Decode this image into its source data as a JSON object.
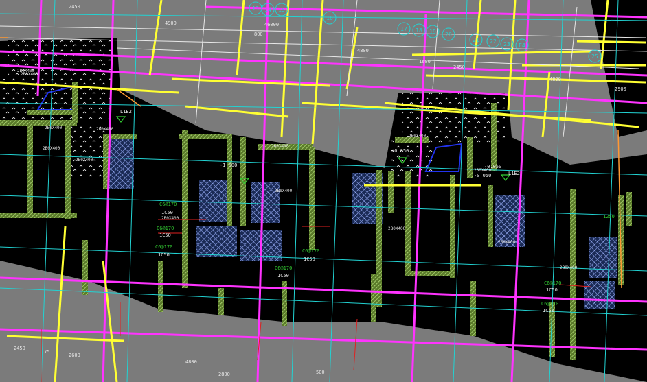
{
  "drawing": {
    "background": "#000000",
    "gray_fill": "#7b7b7b",
    "colors": {
      "magenta": "#ff33ff",
      "yellow": "#ffff33",
      "cyan": "#22d3d3",
      "white": "#e8e8e8",
      "green": "#33cc33",
      "red": "#e02020",
      "blue": "#2233ee",
      "orange": "#ff9933",
      "hatch": "#9fd36a"
    }
  },
  "grid_labels": [
    "13",
    "14",
    "15",
    "16",
    "17",
    "18",
    "19",
    "20",
    "21",
    "22",
    "23",
    "E4",
    "25"
  ],
  "dimensions": [
    "2450",
    "4900",
    "800",
    "46000",
    "4800",
    "1600",
    "2450",
    "4800",
    "2900",
    "2450",
    "175",
    "2600",
    "4800",
    "2800",
    "500"
  ],
  "room_tags": [
    "2B0X400",
    "2B0X400",
    "2B0X400",
    "2B0X400",
    "2B0X400",
    "2B0X400",
    "2B0X400",
    "2B0X400",
    "2B0X400",
    "2B0X400",
    "2B0X400",
    "2B0X400",
    "2B0X400",
    "2B0X400"
  ],
  "elevations": [
    "-1.500",
    "+0.050",
    "-0.050",
    "-0.050",
    "L1E2",
    "L1E2"
  ],
  "rebar_notes": [
    "C6@170",
    "1C50",
    "C6@170",
    "1C50",
    "C6@170",
    "1C50",
    "C6@170",
    "1C50",
    "C6@170",
    "1C50",
    "C6@170",
    "1C50",
    "C6@170",
    "1C50",
    "1250"
  ]
}
